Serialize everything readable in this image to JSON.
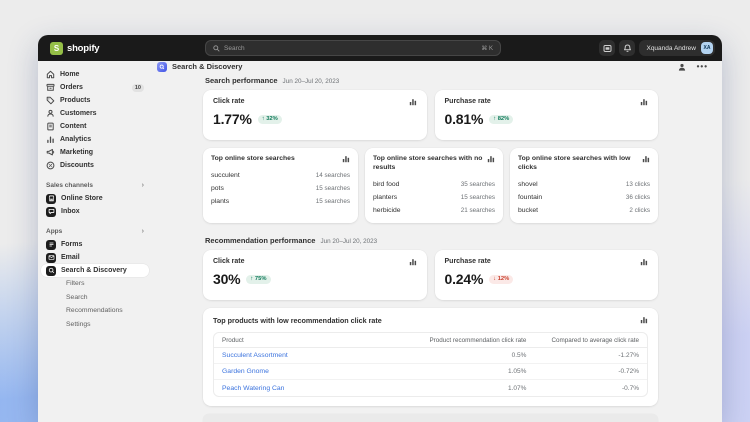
{
  "topbar": {
    "logo_text": "shopify",
    "logo_initial": "S",
    "search_placeholder": "Search",
    "search_shortcut": "⌘ K",
    "user_name": "Xquanda Andrew",
    "user_initials": "XA"
  },
  "sidebar": {
    "items": [
      {
        "label": "Home"
      },
      {
        "label": "Orders",
        "badge": "10"
      },
      {
        "label": "Products"
      },
      {
        "label": "Customers"
      },
      {
        "label": "Content"
      },
      {
        "label": "Analytics"
      },
      {
        "label": "Marketing"
      },
      {
        "label": "Discounts"
      }
    ],
    "sales_channels": {
      "label": "Sales channels",
      "chevron": "›",
      "items": [
        {
          "label": "Online Store"
        },
        {
          "label": "Inbox"
        }
      ]
    },
    "apps": {
      "label": "Apps",
      "chevron": "›",
      "items": [
        {
          "label": "Forms"
        },
        {
          "label": "Email"
        },
        {
          "label": "Search & Discovery"
        }
      ]
    },
    "app_subitems": [
      {
        "label": "Filters"
      },
      {
        "label": "Search"
      },
      {
        "label": "Recommendations"
      },
      {
        "label": "Settings"
      }
    ]
  },
  "page": {
    "title": "Search & Discovery"
  },
  "search_performance": {
    "title": "Search performance",
    "date_range": "Jun 20–Jul 20, 2023",
    "metrics": [
      {
        "label": "Click rate",
        "value": "1.77%",
        "change": "↑ 32%",
        "trend": "up"
      },
      {
        "label": "Purchase rate",
        "value": "0.81%",
        "change": "↑ 82%",
        "trend": "up"
      }
    ],
    "lists": [
      {
        "title": "Top online store searches",
        "rows": [
          {
            "term": "succulent",
            "count": "14 searches"
          },
          {
            "term": "pots",
            "count": "15 searches"
          },
          {
            "term": "plants",
            "count": "15 searches"
          }
        ]
      },
      {
        "title": "Top online store searches with no results",
        "rows": [
          {
            "term": "bird food",
            "count": "35 searches"
          },
          {
            "term": "planters",
            "count": "15 searches"
          },
          {
            "term": "herbicide",
            "count": "21 searches"
          }
        ]
      },
      {
        "title": "Top online store searches with low clicks",
        "rows": [
          {
            "term": "shovel",
            "count": "13 clicks"
          },
          {
            "term": "fountain",
            "count": "36 clicks"
          },
          {
            "term": "bucket",
            "count": "2 clicks"
          }
        ]
      }
    ]
  },
  "recommendation_performance": {
    "title": "Recommendation performance",
    "date_range": "Jun 20–Jul 20, 2023",
    "metrics": [
      {
        "label": "Click rate",
        "value": "30%",
        "change": "↑ 75%",
        "trend": "up"
      },
      {
        "label": "Purchase rate",
        "value": "0.24%",
        "change": "↓ 12%",
        "trend": "down"
      }
    ]
  },
  "low_click_table": {
    "title": "Top products with low recommendation click rate",
    "columns": [
      "Product",
      "Product recommendation click rate",
      "Compared to average click rate"
    ],
    "rows": [
      {
        "product": "Succulent Assortment",
        "rate": "0.5%",
        "compared": "-1.27%"
      },
      {
        "product": "Garden Gnome",
        "rate": "1.05%",
        "compared": "-0.72%"
      },
      {
        "product": "Peach Watering Can",
        "rate": "1.07%",
        "compared": "-0.7%"
      }
    ]
  },
  "colors": {
    "brand_green": "#95bf47",
    "success_text": "#0f7a5a",
    "critical_text": "#c9402e",
    "link_blue": "#3b73de"
  }
}
